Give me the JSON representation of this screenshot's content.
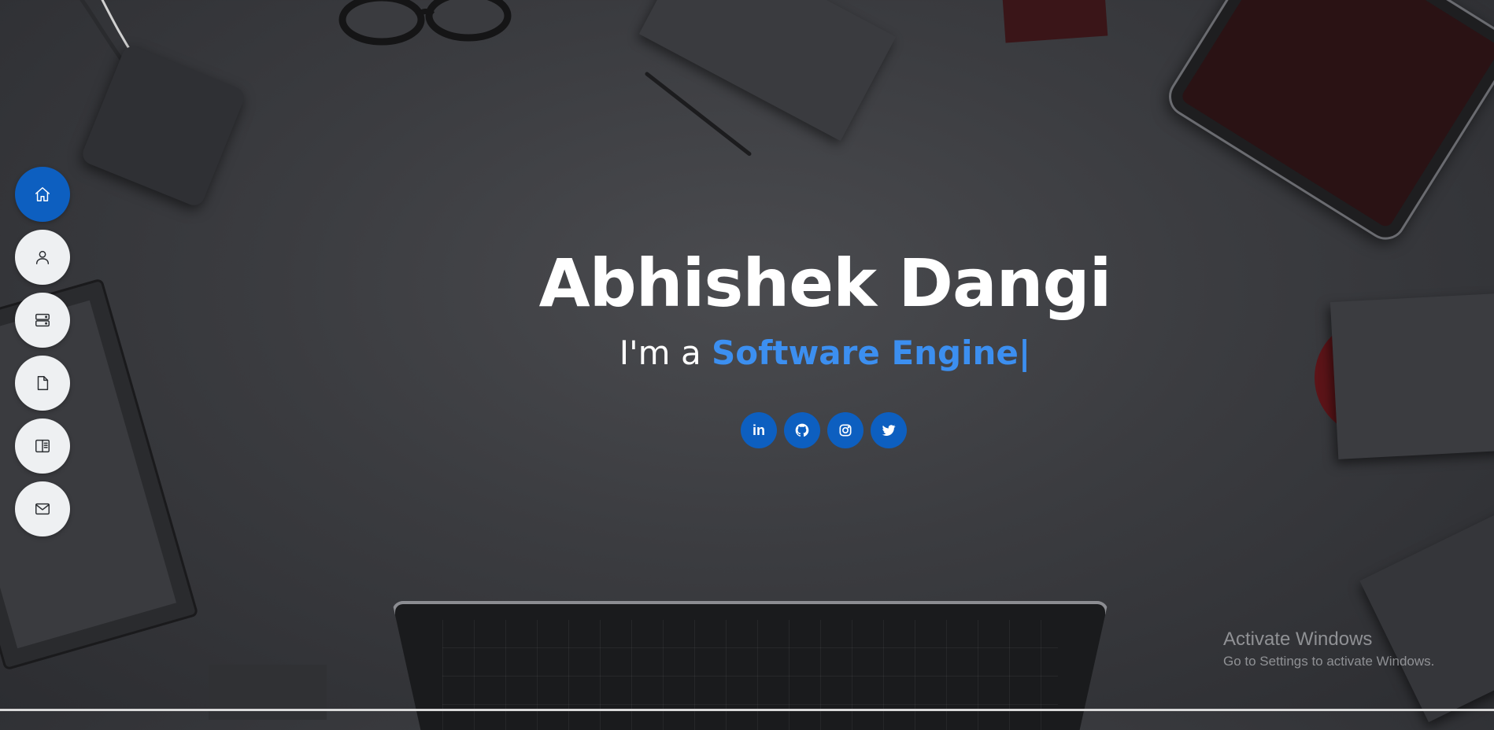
{
  "hero": {
    "name": "Abhishek Dangi",
    "tagline_prefix": "I'm a ",
    "tagline_role": "Software Engine",
    "cursor": "|"
  },
  "sidebar": {
    "items": [
      {
        "icon": "home-icon",
        "active": true
      },
      {
        "icon": "user-icon",
        "active": false
      },
      {
        "icon": "server-icon",
        "active": false
      },
      {
        "icon": "file-icon",
        "active": false
      },
      {
        "icon": "book-icon",
        "active": false
      },
      {
        "icon": "mail-icon",
        "active": false
      }
    ]
  },
  "socials": [
    {
      "icon": "linkedin-icon",
      "label": "in"
    },
    {
      "icon": "github-icon"
    },
    {
      "icon": "instagram-icon"
    },
    {
      "icon": "twitter-icon"
    }
  ],
  "watermark": {
    "title": "Activate Windows",
    "subtitle": "Go to Settings to activate Windows."
  },
  "colors": {
    "accent": "#0d5fc0",
    "highlight": "#3c8ff0",
    "nav_bg": "#eef0f2",
    "text": "#ffffff"
  }
}
